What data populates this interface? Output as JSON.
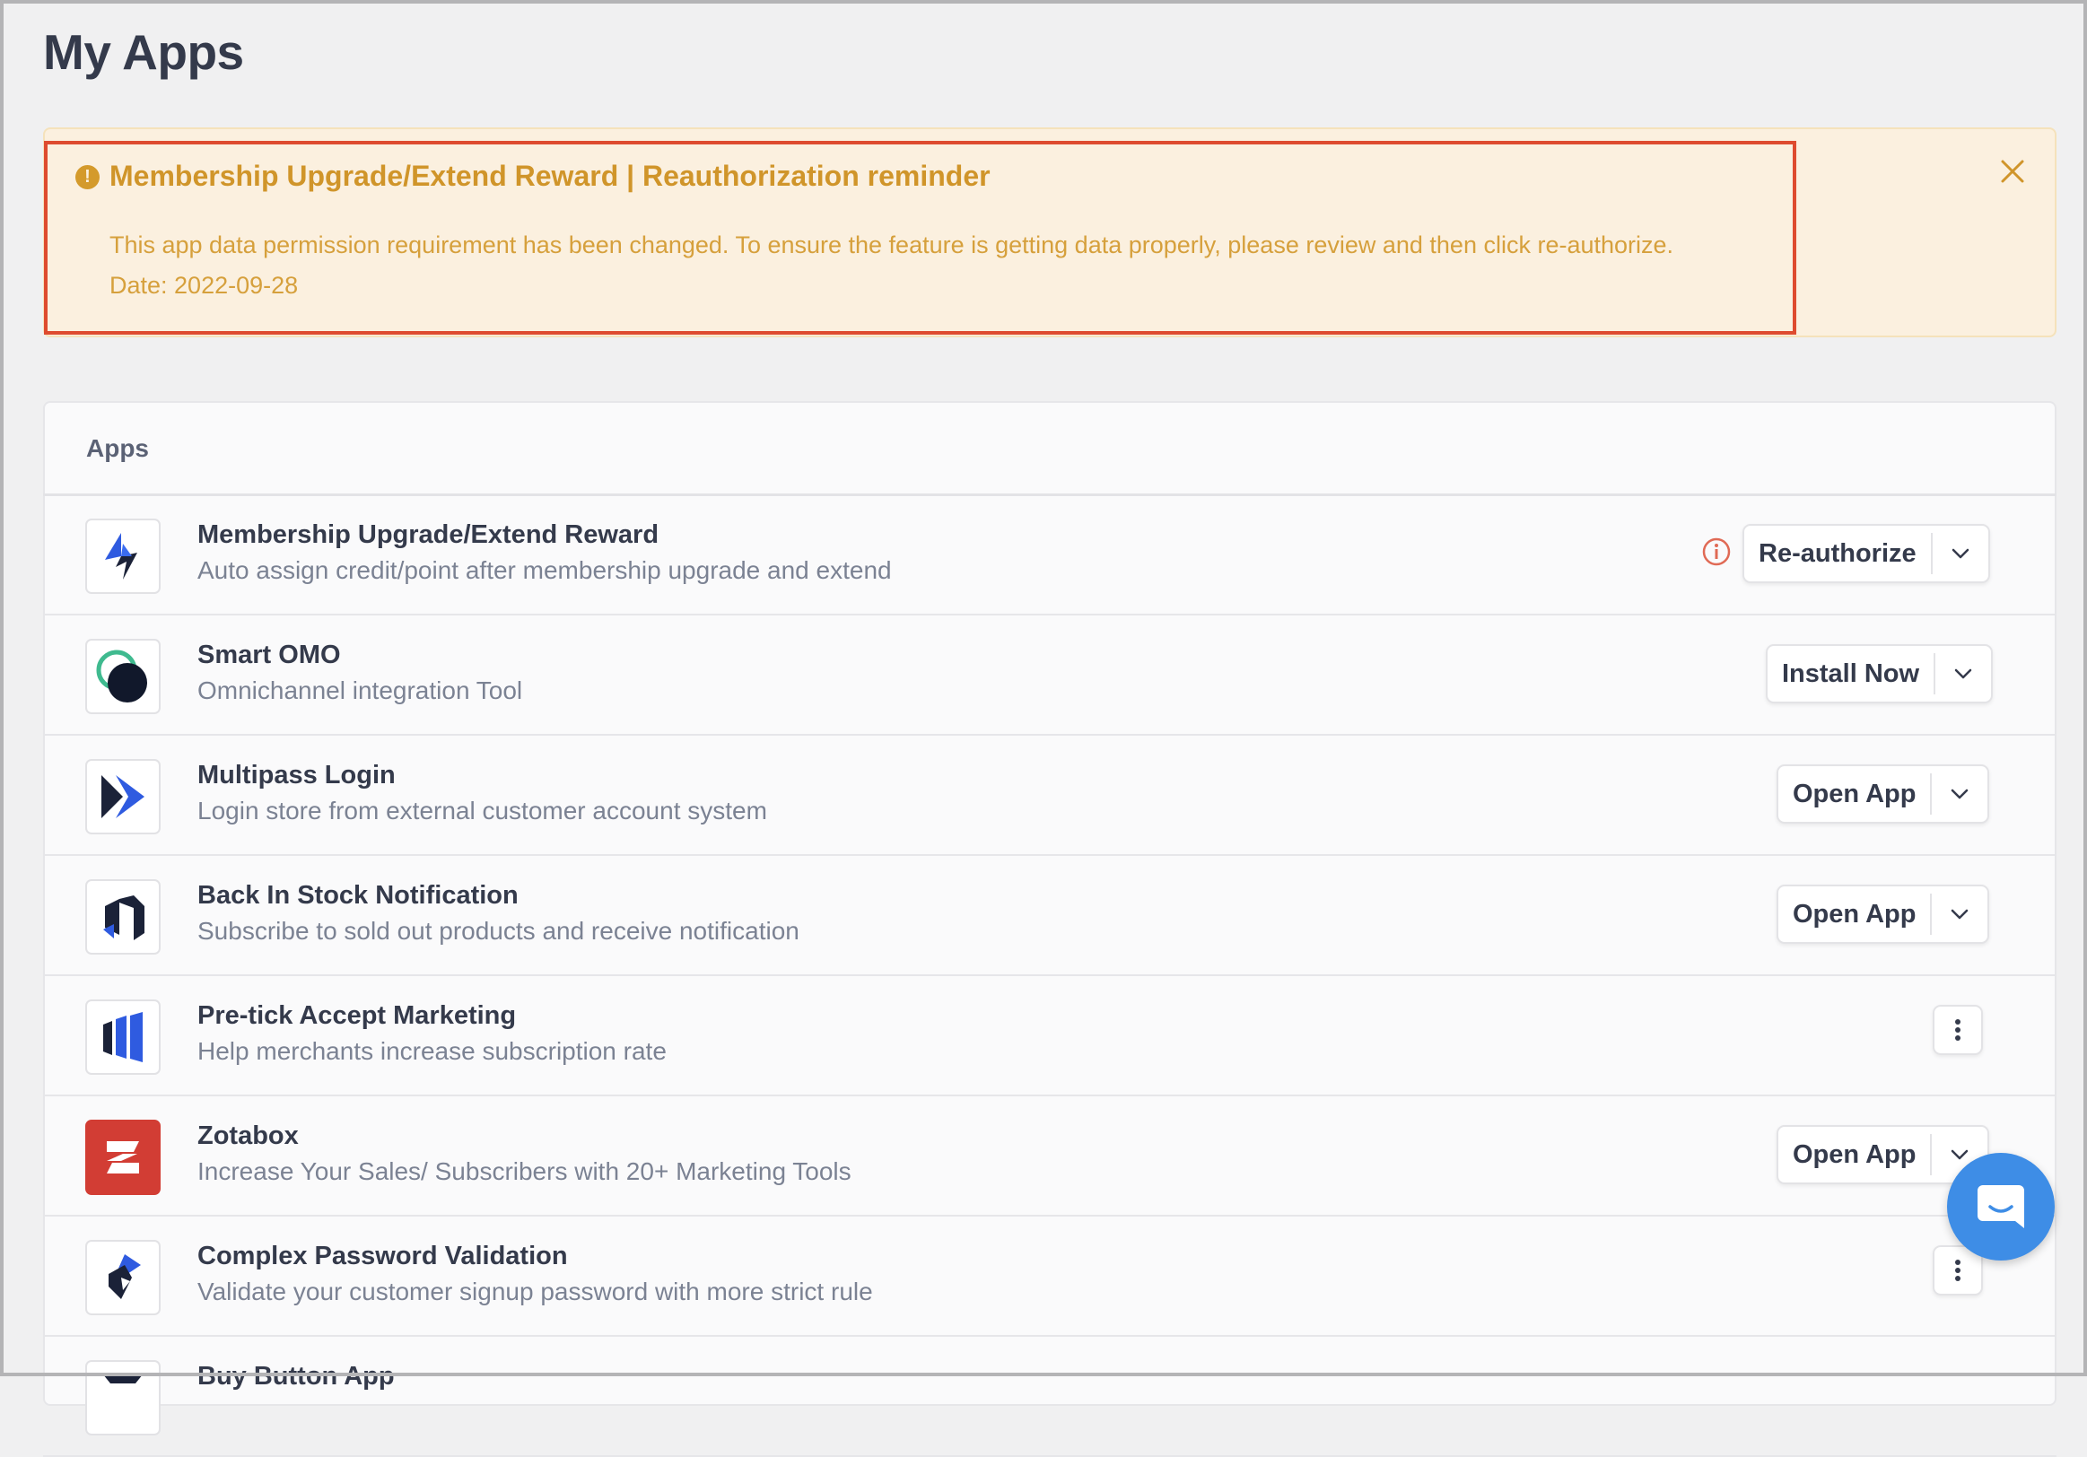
{
  "page": {
    "title": "My Apps"
  },
  "banner": {
    "title": "Membership Upgrade/Extend Reward | Reauthorization reminder",
    "message": "This app data permission requirement has been changed. To ensure the feature is getting data properly, please review and then click re-authorize.",
    "date": "Date: 2022-09-28",
    "color": "#d0952a"
  },
  "apps_section": {
    "header": "Apps",
    "items": [
      {
        "name": "Membership Upgrade/Extend Reward",
        "description": "Auto assign credit/point after membership upgrade and extend",
        "action": "Re-authorize",
        "icon": "lightning-icon"
      },
      {
        "name": "Smart OMO",
        "description": "Omnichannel integration Tool",
        "action": "Install Now",
        "icon": "omo-icon"
      },
      {
        "name": "Multipass Login",
        "description": "Login store from external customer account system",
        "action": "Open App",
        "icon": "multipass-icon"
      },
      {
        "name": "Back In Stock Notification",
        "description": "Subscribe to sold out products and receive notification",
        "action": "Open App",
        "icon": "stock-icon"
      },
      {
        "name": "Pre-tick Accept Marketing",
        "description": "Help merchants increase subscription rate",
        "action": "",
        "icon": "marketing-icon"
      },
      {
        "name": "Zotabox",
        "description": "Increase Your Sales/ Subscribers with 20+ Marketing Tools",
        "action": "Open App",
        "icon": "zotabox-icon"
      },
      {
        "name": "Complex Password Validation",
        "description": "Validate your customer signup password with more strict rule",
        "action": "",
        "icon": "password-icon"
      },
      {
        "name": "Buy Button App",
        "description": "",
        "action": "",
        "icon": "buy-button-icon"
      }
    ]
  },
  "colors": {
    "accent": "#2f5be0",
    "warning": "#d0952a",
    "highlight": "#de4b2f",
    "chat": "#3e8de6"
  }
}
